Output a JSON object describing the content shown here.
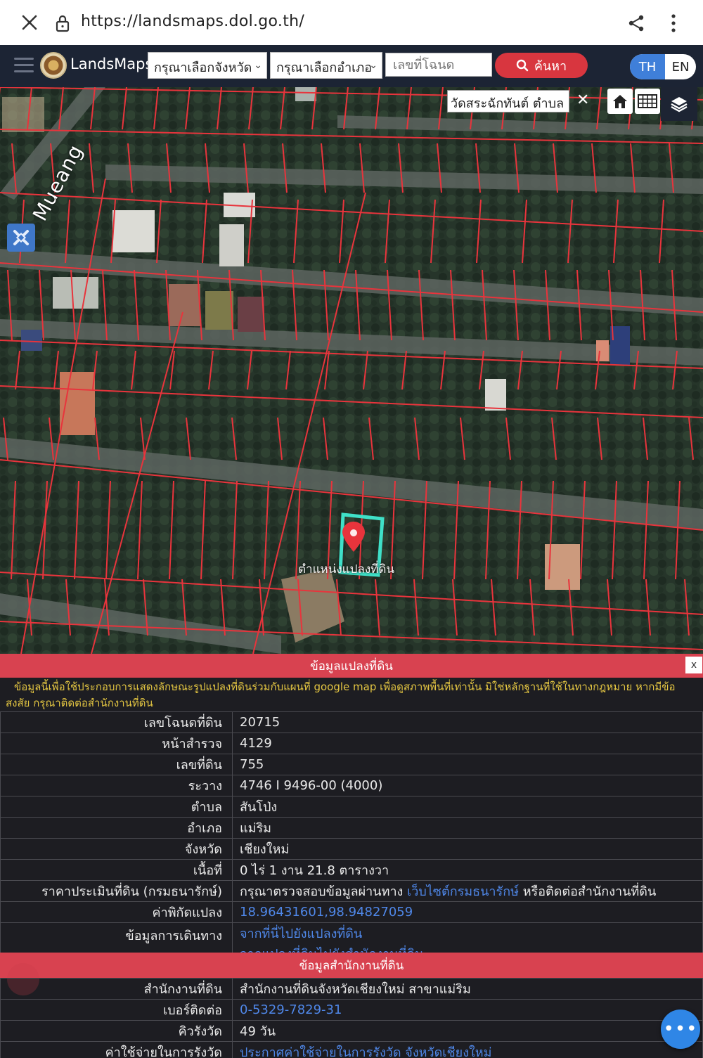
{
  "browser": {
    "url": "https://landsmaps.dol.go.th/"
  },
  "header": {
    "brand": "LandsMaps",
    "province_select": "กรุณาเลือกจังหวัด",
    "district_select": "กรุณาเลือกอำเภอ",
    "deed_placeholder": "เลขที่โฉนด",
    "search_label": "ค้นหา",
    "lang_th": "TH",
    "lang_en": "EN"
  },
  "map": {
    "search_value": "วัดสระฉักทันต์ ตำบล",
    "close_glyph": "✕",
    "road_label": "Mueang",
    "pin_label": "ตำแหน่งแปลงที่ดิน",
    "colors": {
      "parcel_line": "#e8343c",
      "selected_parcel": "#3fe0c8",
      "pin": "#e8343c"
    }
  },
  "panel": {
    "title": "ข้อมูลแปลงที่ดิน",
    "close_glyph": "x",
    "disclaimer_line1": "ข้อมูลนี้เพื่อใช้ประกอบการแสดงลักษณะรูปแปลงที่ดินร่วมกับแผนที่ google map เพื่อดูสภาพพื้นที่เท่านั้น มิใช่หลักฐานที่ใช้ในทางกฎหมาย หากมีข้อ",
    "disclaimer_line2": "สงสัย กรุณาติดต่อสำนักงานที่ดิน",
    "rows": [
      {
        "key": "เลขโฉนดที่ดิน",
        "value": "20715"
      },
      {
        "key": "หน้าสำรวจ",
        "value": "4129"
      },
      {
        "key": "เลขที่ดิน",
        "value": "755"
      },
      {
        "key": "ระวาง",
        "value": "4746 I 9496-00 (4000)"
      },
      {
        "key": "ตำบล",
        "value": "สันโป่ง"
      },
      {
        "key": "อำเภอ",
        "value": "แม่ริม"
      },
      {
        "key": "จังหวัด",
        "value": "เชียงใหม่"
      },
      {
        "key": "เนื้อที่",
        "value": "0 ไร่ 1 งาน 21.8 ตารางวา"
      }
    ],
    "appraisal": {
      "key": "ราคาประเมินที่ดิน (กรมธนารักษ์)",
      "prefix": "กรุณาตรวจสอบข้อมูลผ่านทาง ",
      "link": "เว็บไซต์กรมธนารักษ์",
      "suffix": " หรือติดต่อสำนักงานที่ดิน"
    },
    "coords": {
      "key": "ค่าพิกัดแปลง",
      "value": "18.96431601,98.94827059"
    },
    "directions": {
      "key": "ข้อมูลการเดินทาง",
      "link1": "จากที่นี่ไปยังแปลงที่ดิน",
      "link2": "จากแปลงที่ดินไปยังสำนักงานที่ดิน"
    }
  },
  "office": {
    "title": "ข้อมูลสำนักงานที่ดิน",
    "rows": [
      {
        "key": "สำนักงานที่ดิน",
        "value": "สำนักงานที่ดินจังหวัดเชียงใหม่ สาขาแม่ริม",
        "link": false
      },
      {
        "key": "เบอร์ติดต่อ",
        "value": "0-5329-7829-31",
        "link": true
      },
      {
        "key": "คิวรังวัด",
        "value": "49 วัน",
        "link": false
      },
      {
        "key": "ค่าใช้จ่ายในการรังวัด",
        "value": "ประกาศค่าใช้จ่ายในการรังวัด จังหวัดเชียงใหม่",
        "link": true
      }
    ]
  },
  "fab": {
    "label": "•••"
  }
}
